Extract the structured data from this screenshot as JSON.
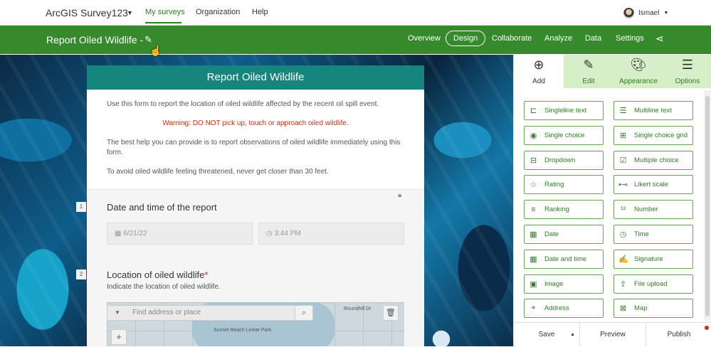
{
  "topbar": {
    "app_name": "ArcGIS Survey123",
    "nav": [
      "My surveys",
      "Organization",
      "Help"
    ],
    "user": "Ismael"
  },
  "surveybar": {
    "title": "Report Oiled Wildlife -",
    "tabs": [
      "Overview",
      "Design",
      "Collaborate",
      "Analyze",
      "Data",
      "Settings"
    ],
    "active_tab": "Design"
  },
  "form": {
    "header": "Report Oiled Wildlife",
    "intro1": "Use this form to report the location of oiled wildlife affected by the recent oil spill event.",
    "warning": "Warning: DO NOT pick up, touch or approach oiled wildlife.",
    "intro2": "The best help you can provide is to report observations of oiled wildlife immediately using this form.",
    "intro3": "To avoid oiled wildlife feeling threatened, never get closer than 30 feet.",
    "q1": {
      "number": "1",
      "title": "Date and time of the report",
      "date": "6/21/22",
      "time": "3:44 PM"
    },
    "q2": {
      "number": "2",
      "title": "Location of oiled wildlife",
      "required_mark": "*",
      "hint": "Indicate the location of oiled wildlife.",
      "search_placeholder": "Find address or place",
      "map_label": "Sunset Beach Linear Park",
      "map_label2": "Roundhill Dr"
    }
  },
  "panel": {
    "tabs": [
      {
        "label": "Add",
        "icon": "plus-circle-icon"
      },
      {
        "label": "Edit",
        "icon": "pencil-icon"
      },
      {
        "label": "Appearance",
        "icon": "palette-icon"
      },
      {
        "label": "Options",
        "icon": "sliders-icon"
      }
    ],
    "question_types": [
      {
        "label": "Singleline text",
        "icon": "singleline-text-icon"
      },
      {
        "label": "Multiline text",
        "icon": "multiline-text-icon"
      },
      {
        "label": "Single choice",
        "icon": "radio-icon"
      },
      {
        "label": "Single choice grid",
        "icon": "grid-choice-icon"
      },
      {
        "label": "Dropdown",
        "icon": "dropdown-icon"
      },
      {
        "label": "Multiple choice",
        "icon": "checkbox-icon"
      },
      {
        "label": "Rating",
        "icon": "star-icon"
      },
      {
        "label": "Likert scale",
        "icon": "likert-icon"
      },
      {
        "label": "Ranking",
        "icon": "ranking-icon"
      },
      {
        "label": "Number",
        "icon": "number-icon"
      },
      {
        "label": "Date",
        "icon": "calendar-icon"
      },
      {
        "label": "Time",
        "icon": "clock-icon"
      },
      {
        "label": "Date and time",
        "icon": "date-time-icon"
      },
      {
        "label": "Signature",
        "icon": "signature-icon"
      },
      {
        "label": "Image",
        "icon": "image-icon"
      },
      {
        "label": "File upload",
        "icon": "upload-icon"
      },
      {
        "label": "Address",
        "icon": "location-pin-icon"
      },
      {
        "label": "Map",
        "icon": "map-icon"
      }
    ],
    "footer": [
      "Save",
      "Preview",
      "Publish"
    ]
  },
  "colors": {
    "brand_green": "#368a2b",
    "form_header": "#15857d",
    "warning": "#d42a10"
  }
}
